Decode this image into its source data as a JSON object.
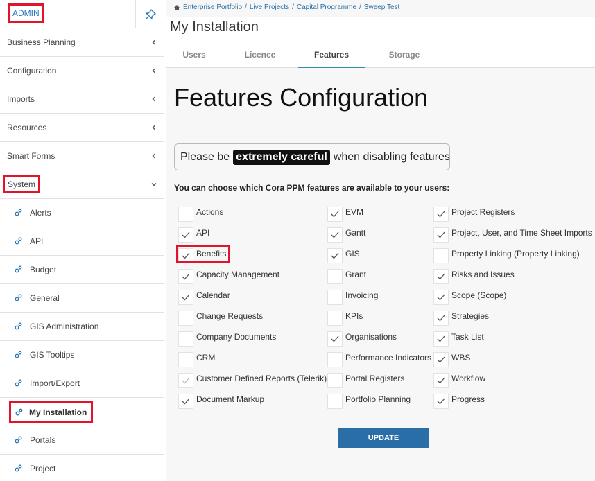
{
  "sidebar": {
    "admin_label": "ADMIN",
    "items": [
      {
        "label": "Business Planning"
      },
      {
        "label": "Configuration"
      },
      {
        "label": "Imports"
      },
      {
        "label": "Resources"
      },
      {
        "label": "Smart Forms"
      },
      {
        "label": "System"
      }
    ],
    "system_children": [
      {
        "label": "Alerts"
      },
      {
        "label": "API"
      },
      {
        "label": "Budget"
      },
      {
        "label": "General"
      },
      {
        "label": "GIS Administration"
      },
      {
        "label": "GIS Tooltips"
      },
      {
        "label": "Import/Export"
      },
      {
        "label": "My Installation"
      },
      {
        "label": "Portals"
      },
      {
        "label": "Project"
      }
    ]
  },
  "breadcrumb": [
    "Enterprise Portfolio",
    "Live Projects",
    "Capital Programme",
    "Sweep Test"
  ],
  "breadcrumb_sep": "/",
  "page_title": "My Installation",
  "tabs": [
    {
      "label": "Users"
    },
    {
      "label": "Licence"
    },
    {
      "label": "Features",
      "active": true
    },
    {
      "label": "Storage"
    }
  ],
  "features_title": "Features Configuration",
  "warning": {
    "prefix": "Please be",
    "emphasis": "extremely careful",
    "suffix": "when disabling features"
  },
  "description": "You can choose which Cora PPM features are available to your users:",
  "features": {
    "col1": [
      {
        "label": "Actions",
        "checked": false
      },
      {
        "label": "API",
        "checked": true
      },
      {
        "label": "Benefits",
        "checked": true
      },
      {
        "label": "Capacity Management",
        "checked": true
      },
      {
        "label": "Calendar",
        "checked": true
      },
      {
        "label": "Change Requests",
        "checked": false
      },
      {
        "label": "Company Documents",
        "checked": false
      },
      {
        "label": "CRM",
        "checked": false
      },
      {
        "label": "Customer Defined Reports (Telerik)",
        "checked": true,
        "disabled": true
      },
      {
        "label": "Document Markup",
        "checked": true
      }
    ],
    "col2": [
      {
        "label": "EVM",
        "checked": true
      },
      {
        "label": "Gantt",
        "checked": true
      },
      {
        "label": "GIS",
        "checked": true
      },
      {
        "label": "Grant",
        "checked": false,
        "disabled": true
      },
      {
        "label": "Invoicing",
        "checked": false
      },
      {
        "label": "KPIs",
        "checked": false
      },
      {
        "label": "Organisations",
        "checked": true
      },
      {
        "label": "Performance Indicators",
        "checked": false,
        "disabled": true
      },
      {
        "label": "Portal Registers",
        "checked": false,
        "disabled": true
      },
      {
        "label": "Portfolio Planning",
        "checked": false,
        "disabled": true
      }
    ],
    "col3": [
      {
        "label": "Project Registers",
        "checked": true
      },
      {
        "label": "Project, User, and Time Sheet Imports",
        "checked": true
      },
      {
        "label": "Property Linking (Property Linking)",
        "checked": false,
        "disabled": true
      },
      {
        "label": "Risks and Issues",
        "checked": true
      },
      {
        "label": "Scope (Scope)",
        "checked": true
      },
      {
        "label": "Strategies",
        "checked": true
      },
      {
        "label": "Task List",
        "checked": true
      },
      {
        "label": "WBS",
        "checked": true
      },
      {
        "label": "Workflow",
        "checked": true
      },
      {
        "label": "Progress",
        "checked": true
      }
    ]
  },
  "update_label": "UPDATE",
  "colors": {
    "accent": "#2a6ea8",
    "highlight": "#e0142a",
    "tab_underline": "#2a8fa8"
  }
}
